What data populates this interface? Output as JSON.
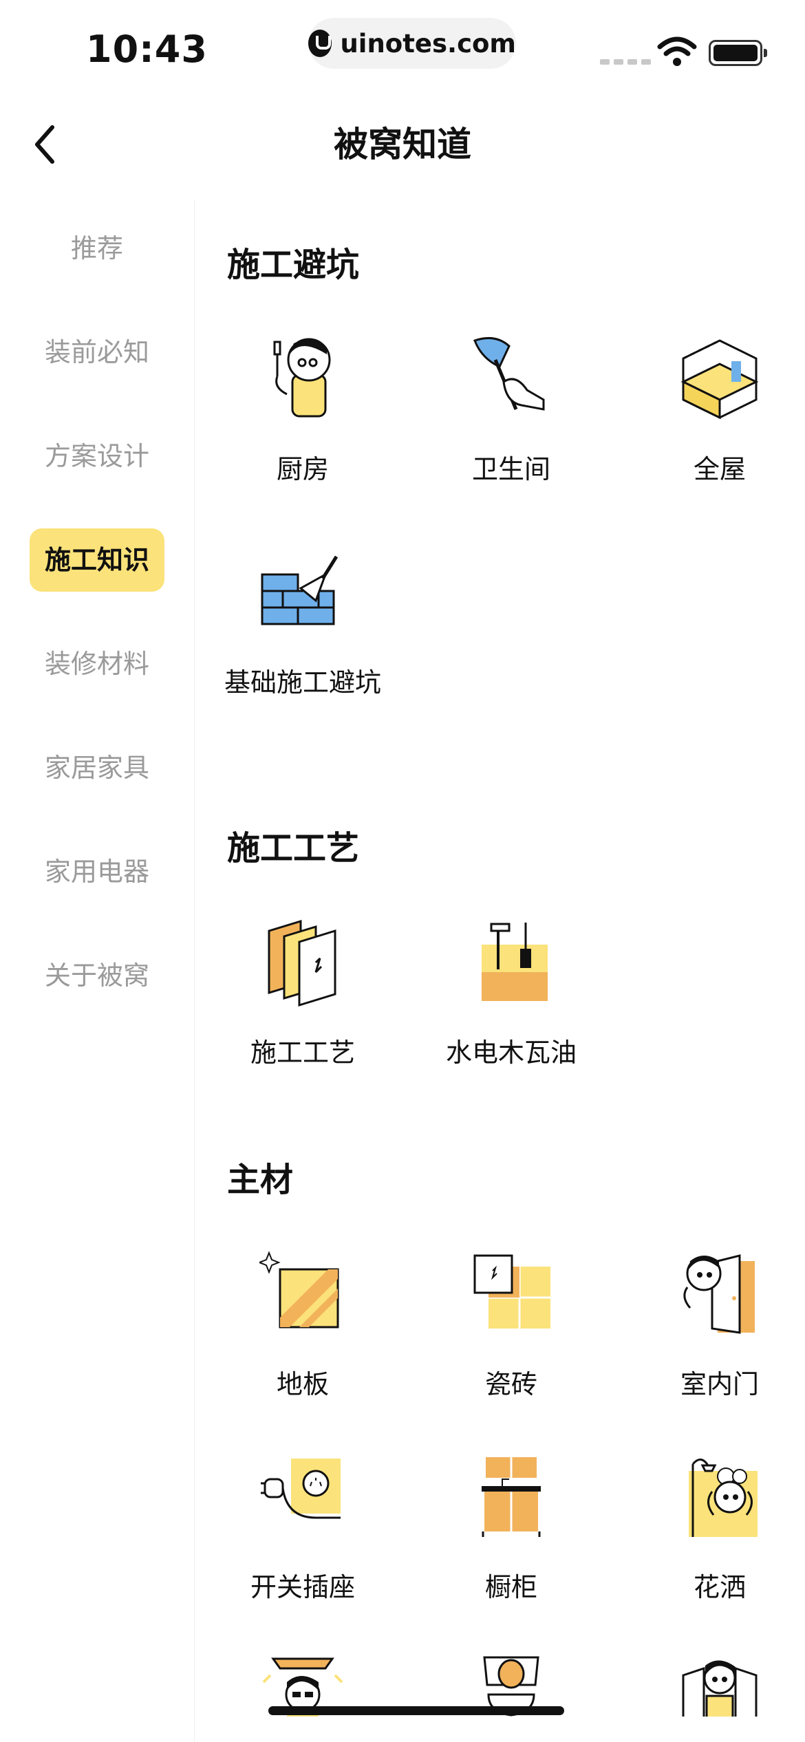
{
  "status_bar": {
    "time": "10:43",
    "url": "uinotes.com"
  },
  "header": {
    "title": "被窝知道"
  },
  "sidebar": {
    "items": [
      {
        "label": "推荐"
      },
      {
        "label": "装前必知"
      },
      {
        "label": "方案设计"
      },
      {
        "label": "施工知识"
      },
      {
        "label": "装修材料"
      },
      {
        "label": "家居家具"
      },
      {
        "label": "家用电器"
      },
      {
        "label": "关于被窝"
      }
    ],
    "active_index": 3
  },
  "sections": [
    {
      "title": "施工避坑",
      "items": [
        {
          "label": "厨房",
          "icon": "chef-icon"
        },
        {
          "label": "卫生间",
          "icon": "plunger-icon"
        },
        {
          "label": "全屋",
          "icon": "room-cube-icon"
        },
        {
          "label": "基础施工避坑",
          "icon": "brick-trowel-icon"
        }
      ]
    },
    {
      "title": "施工工艺",
      "items": [
        {
          "label": "施工工艺",
          "icon": "panels-icon"
        },
        {
          "label": "水电木瓦油",
          "icon": "toolbox-icon"
        }
      ]
    },
    {
      "title": "主材",
      "items": [
        {
          "label": "地板",
          "icon": "floor-icon"
        },
        {
          "label": "瓷砖",
          "icon": "tile-icon"
        },
        {
          "label": "室内门",
          "icon": "door-icon"
        },
        {
          "label": "开关插座",
          "icon": "socket-icon"
        },
        {
          "label": "橱柜",
          "icon": "cabinet-icon"
        },
        {
          "label": "花洒",
          "icon": "shower-icon"
        },
        {
          "label": "",
          "icon": "ceiling-lamp-icon"
        },
        {
          "label": "",
          "icon": "toilet-icon"
        },
        {
          "label": "",
          "icon": "window-icon"
        }
      ]
    }
  ],
  "colors": {
    "accent": "#fbe27a",
    "orange": "#f2b25a",
    "blue": "#6fb0ea",
    "inactive_text": "#9a9a9a"
  }
}
